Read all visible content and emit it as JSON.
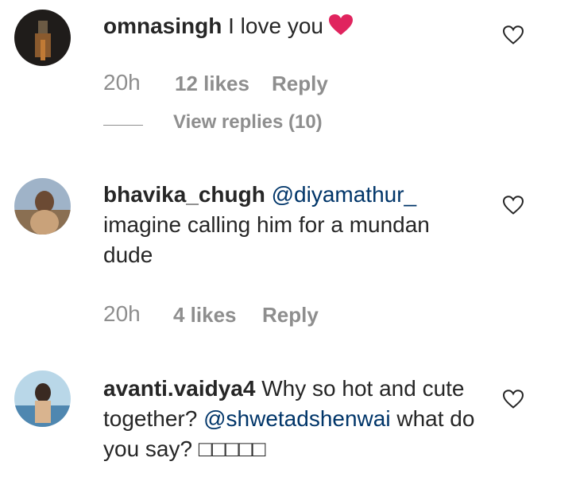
{
  "comments": [
    {
      "username": "omnasingh",
      "text": "I love you",
      "emoji": "heart",
      "time": "20h",
      "likes": "12 likes",
      "reply_label": "Reply",
      "view_replies": "View replies (10)"
    },
    {
      "username": "bhavika_chugh",
      "mention": "@diyamathur_",
      "text": "imagine calling him for a mundan dude",
      "time": "20h",
      "likes": "4 likes",
      "reply_label": "Reply"
    },
    {
      "username": "avanti.vaidya4",
      "text_part1": "Why so hot and cute together?",
      "mention": "@shwetadshenwai",
      "text_part2": "what do you say? □□□□□"
    }
  ],
  "icons": {
    "like": "heart-outline-icon",
    "emoji": "red-heart-icon"
  },
  "colors": {
    "text": "#262626",
    "meta": "#8e8e8e",
    "mention": "#003569",
    "heart_emoji": "#e0245e"
  }
}
